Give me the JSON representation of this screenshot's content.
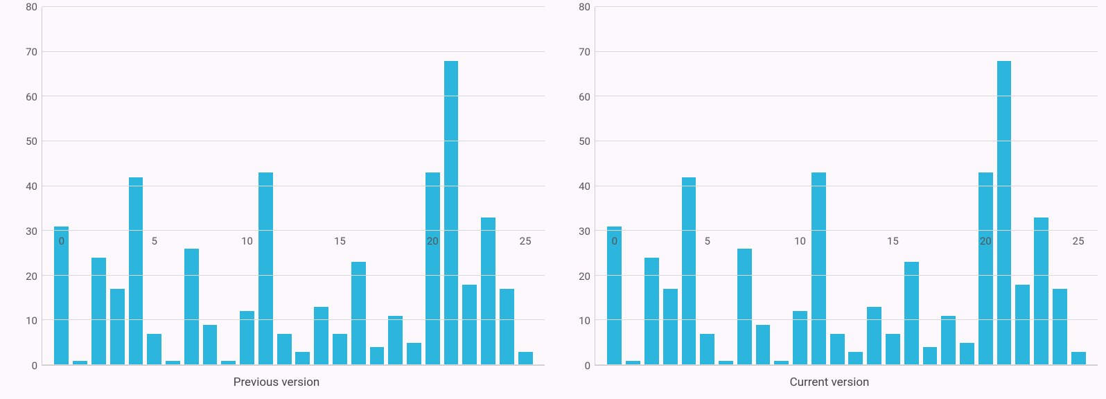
{
  "chart_data": [
    {
      "type": "bar",
      "subtitle": "Previous version",
      "x": [
        0,
        1,
        2,
        3,
        4,
        5,
        6,
        7,
        8,
        9,
        10,
        11,
        12,
        13,
        14,
        15,
        16,
        17,
        18,
        19,
        20,
        21,
        22,
        23,
        24,
        25
      ],
      "values": [
        31,
        1,
        24,
        17,
        42,
        7,
        1,
        26,
        9,
        1,
        12,
        43,
        7,
        3,
        13,
        7,
        23,
        4,
        11,
        5,
        43,
        68,
        18,
        33,
        17,
        3
      ],
      "x_ticks": [
        0,
        5,
        10,
        15,
        20,
        25
      ],
      "y_ticks": [
        0,
        10,
        20,
        30,
        40,
        50,
        60,
        70,
        80
      ],
      "ylim": [
        0,
        80
      ],
      "x_axis_at": 30,
      "bar_color": "#2db6dd"
    },
    {
      "type": "bar",
      "subtitle": "Current version",
      "x": [
        0,
        1,
        2,
        3,
        4,
        5,
        6,
        7,
        8,
        9,
        10,
        11,
        12,
        13,
        14,
        15,
        16,
        17,
        18,
        19,
        20,
        21,
        22,
        23,
        24,
        25
      ],
      "values": [
        31,
        1,
        24,
        17,
        42,
        7,
        1,
        26,
        9,
        1,
        12,
        43,
        7,
        3,
        13,
        7,
        23,
        4,
        11,
        5,
        43,
        68,
        18,
        33,
        17,
        3
      ],
      "x_ticks": [
        0,
        5,
        10,
        15,
        20,
        25
      ],
      "y_ticks": [
        0,
        10,
        20,
        30,
        40,
        50,
        60,
        70,
        80
      ],
      "ylim": [
        0,
        80
      ],
      "x_axis_at": 30,
      "bar_color": "#2db6dd"
    }
  ]
}
